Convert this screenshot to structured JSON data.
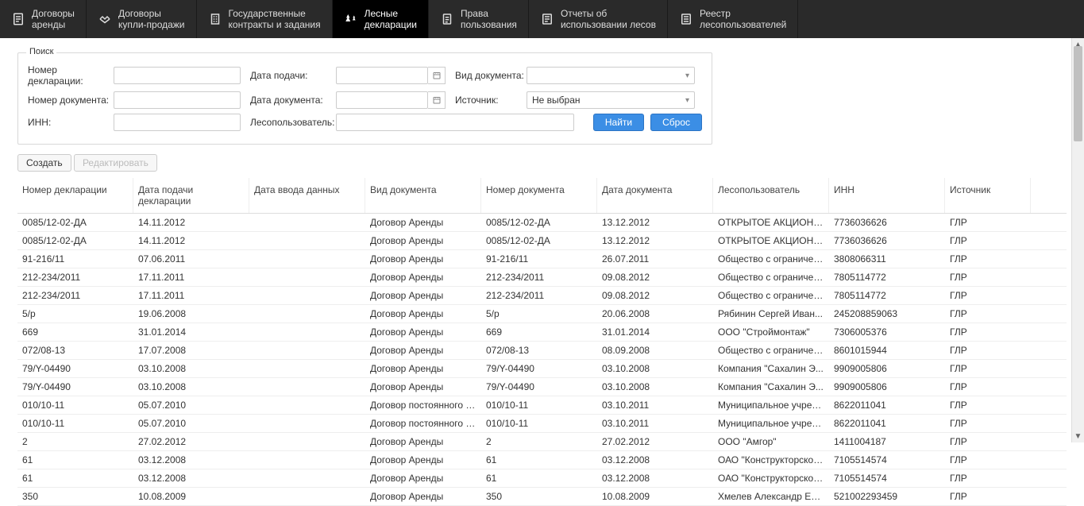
{
  "nav": [
    {
      "label": "Договоры\nаренды"
    },
    {
      "label": "Договоры\nкупли-продажи"
    },
    {
      "label": "Государственные\nконтракты и задания"
    },
    {
      "label": "Лесные\nдекларации"
    },
    {
      "label": "Права\nпользования"
    },
    {
      "label": "Отчеты об\nиспользовании лесов"
    },
    {
      "label": "Реестр\nлесопользователей"
    }
  ],
  "search": {
    "legend": "Поиск",
    "decl_num_label": "Номер декларации:",
    "doc_num_label": "Номер документа:",
    "inn_label": "ИНН:",
    "submit_date_label": "Дата подачи:",
    "doc_date_label": "Дата документа:",
    "user_label": "Лесопользователь:",
    "doc_type_label": "Вид документа:",
    "source_label": "Источник:",
    "source_value": "Не выбран",
    "find_btn": "Найти",
    "reset_btn": "Сброс"
  },
  "actions": {
    "create": "Создать",
    "edit": "Редактировать"
  },
  "columns": [
    "Номер декларации",
    "Дата подачи декларации",
    "Дата ввода данных",
    "Вид документа",
    "Номер документа",
    "Дата документа",
    "Лесопользователь",
    "ИНН",
    "Источник"
  ],
  "rows": [
    [
      "0085/12-02-ДА",
      "14.11.2012",
      "",
      "Договор Аренды",
      "0085/12-02-ДА",
      "13.12.2012",
      "ОТКРЫТОЕ АКЦИОНЕ...",
      "7736036626",
      "ГЛР"
    ],
    [
      "0085/12-02-ДА",
      "14.11.2012",
      "",
      "Договор Аренды",
      "0085/12-02-ДА",
      "13.12.2012",
      "ОТКРЫТОЕ АКЦИОНЕ...",
      "7736036626",
      "ГЛР"
    ],
    [
      "91-216/11",
      "07.06.2011",
      "",
      "Договор Аренды",
      "91-216/11",
      "26.07.2011",
      "Общество с ограничен...",
      "3808066311",
      "ГЛР"
    ],
    [
      "212-234/2011",
      "17.11.2011",
      "",
      "Договор Аренды",
      "212-234/2011",
      "09.08.2012",
      "Общество с ограничен...",
      "7805114772",
      "ГЛР"
    ],
    [
      "212-234/2011",
      "17.11.2011",
      "",
      "Договор Аренды",
      "212-234/2011",
      "09.08.2012",
      "Общество с ограничен...",
      "7805114772",
      "ГЛР"
    ],
    [
      "5/р",
      "19.06.2008",
      "",
      "Договор Аренды",
      "5/р",
      "20.06.2008",
      "Рябинин Сергей Иван...",
      "245208859063",
      "ГЛР"
    ],
    [
      "669",
      "31.01.2014",
      "",
      "Договор Аренды",
      "669",
      "31.01.2014",
      "ООО \"Строймонтаж\"",
      "7306005376",
      "ГЛР"
    ],
    [
      "072/08-13",
      "17.07.2008",
      "",
      "Договор Аренды",
      "072/08-13",
      "08.09.2008",
      "Общество с ограничен...",
      "8601015944",
      "ГЛР"
    ],
    [
      "79/Y-04490",
      "03.10.2008",
      "",
      "Договор Аренды",
      "79/Y-04490",
      "03.10.2008",
      "Компания \"Сахалин Э...",
      "9909005806",
      "ГЛР"
    ],
    [
      "79/Y-04490",
      "03.10.2008",
      "",
      "Договор Аренды",
      "79/Y-04490",
      "03.10.2008",
      "Компания \"Сахалин Э...",
      "9909005806",
      "ГЛР"
    ],
    [
      "010/10-11",
      "05.07.2010",
      "",
      "Договор постоянного (...",
      "010/10-11",
      "03.10.2011",
      "Муниципальное учреж...",
      "8622011041",
      "ГЛР"
    ],
    [
      "010/10-11",
      "05.07.2010",
      "",
      "Договор постоянного (...",
      "010/10-11",
      "03.10.2011",
      "Муниципальное учреж...",
      "8622011041",
      "ГЛР"
    ],
    [
      "2",
      "27.02.2012",
      "",
      "Договор Аренды",
      "2",
      "27.02.2012",
      "ООО \"Амгор\"",
      "1411004187",
      "ГЛР"
    ],
    [
      "61",
      "03.12.2008",
      "",
      "Договор Аренды",
      "61",
      "03.12.2008",
      "ОАО \"Конструкторское...",
      "7105514574",
      "ГЛР"
    ],
    [
      "61",
      "03.12.2008",
      "",
      "Договор Аренды",
      "61",
      "03.12.2008",
      "ОАО \"Конструкторское...",
      "7105514574",
      "ГЛР"
    ],
    [
      "350",
      "10.08.2009",
      "",
      "Договор Аренды",
      "350",
      "10.08.2009",
      "Хмелев Александр Евг...",
      "521002293459",
      "ГЛР"
    ]
  ]
}
